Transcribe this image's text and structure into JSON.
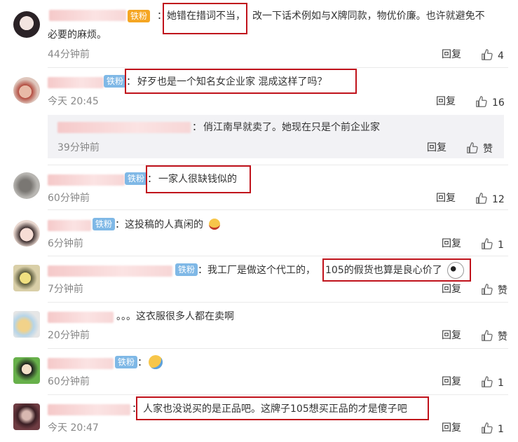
{
  "comments": [
    {
      "text_a": "：",
      "text_b": "她错在措词不当，",
      "text_c": "改一下话术例如与X牌同款，物优价廉。也许就避免不",
      "text_d": "必要的麻烦。",
      "time": "44分钟前",
      "reply": "回复",
      "likes": "4"
    },
    {
      "badge": "铁粉",
      "text_a": "：",
      "text_b": "好歹也是一个知名女企业家 混成这样了吗？",
      "time": "今天 20:45",
      "reply": "回复",
      "likes": "16"
    },
    {
      "sub_sep": "：",
      "sub_text": "俏江南早就卖了。她现在只是个前企业家",
      "sub_time": "39分钟前",
      "sub_reply": "回复",
      "sub_like": "赞"
    },
    {
      "badge": "铁粉",
      "text_a": "：",
      "text_b": "一家人很缺钱似的",
      "time": "60分钟前",
      "reply": "回复",
      "likes": "12"
    },
    {
      "badge": "铁粉",
      "text": "：这投稿的人真闲的",
      "time": "6分钟前",
      "reply": "回复",
      "likes": "1"
    },
    {
      "badge": "铁粉",
      "text": "：我工厂是做这个代工的，",
      "text_b": "105的假货也算是良心价了",
      "time": "7分钟前",
      "reply": "回复",
      "likes": "赞"
    },
    {
      "text": "。。。这衣服很多人都在卖啊",
      "time": "20分钟前",
      "reply": "回复",
      "likes": "赞"
    },
    {
      "badge": "铁粉",
      "text": "：",
      "time": "60分钟前",
      "reply": "回复",
      "likes": "1"
    },
    {
      "text_a": "：",
      "text_b": "人家也没说买的是正品吧。这牌子105想买正品的才是傻子吧",
      "time": "今天 20:47",
      "reply": "回复",
      "likes": "1"
    }
  ],
  "icons": {
    "thumb": "thumbs-up-icon",
    "emoji_grin": "grinning-emoji-icon",
    "emoji_sleepy": "sleepy-emoji-icon",
    "emoji_panda": "panda-emoji-icon"
  },
  "colors": {
    "highlight": "#c0121b",
    "badge": "#7fb8e6",
    "orange_badge": "#f5a623"
  }
}
